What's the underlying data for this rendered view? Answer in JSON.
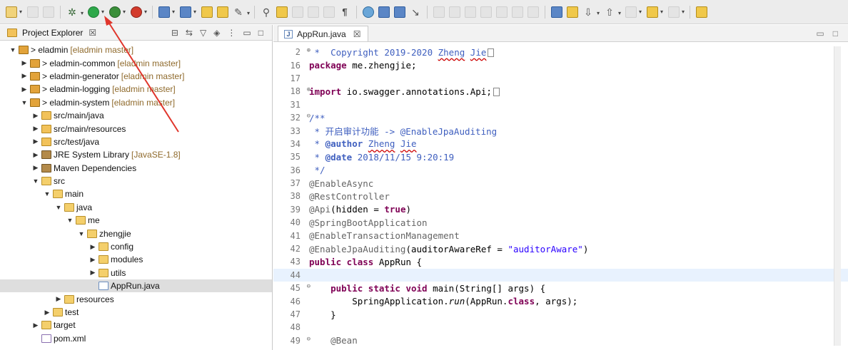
{
  "explorer": {
    "title": "Project Explorer",
    "close": "☒",
    "tree": [
      {
        "label": "> eladmin",
        "decoration": "[eladmin master]",
        "indent": 0,
        "twisty": "▼",
        "icon": "proj"
      },
      {
        "label": "> eladmin-common",
        "decoration": "[eladmin master]",
        "indent": 1,
        "twisty": "▶",
        "icon": "proj"
      },
      {
        "label": "> eladmin-generator",
        "decoration": "[eladmin master]",
        "indent": 1,
        "twisty": "▶",
        "icon": "proj"
      },
      {
        "label": "> eladmin-logging",
        "decoration": "[eladmin master]",
        "indent": 1,
        "twisty": "▶",
        "icon": "proj"
      },
      {
        "label": "> eladmin-system",
        "decoration": "[eladmin master]",
        "indent": 1,
        "twisty": "▼",
        "icon": "proj"
      },
      {
        "label": "src/main/java",
        "decoration": "",
        "indent": 2,
        "twisty": "▶",
        "icon": "pkgf"
      },
      {
        "label": "src/main/resources",
        "decoration": "",
        "indent": 2,
        "twisty": "▶",
        "icon": "pkgf"
      },
      {
        "label": "src/test/java",
        "decoration": "",
        "indent": 2,
        "twisty": "▶",
        "icon": "pkgf"
      },
      {
        "label": "JRE System Library",
        "decoration": "[JavaSE-1.8]",
        "indent": 2,
        "twisty": "▶",
        "icon": "lib"
      },
      {
        "label": "Maven Dependencies",
        "decoration": "",
        "indent": 2,
        "twisty": "▶",
        "icon": "lib"
      },
      {
        "label": "src",
        "decoration": "",
        "indent": 2,
        "twisty": "▼",
        "icon": "folder"
      },
      {
        "label": "main",
        "decoration": "",
        "indent": 3,
        "twisty": "▼",
        "icon": "folder"
      },
      {
        "label": "java",
        "decoration": "",
        "indent": 4,
        "twisty": "▼",
        "icon": "folder"
      },
      {
        "label": "me",
        "decoration": "",
        "indent": 5,
        "twisty": "▼",
        "icon": "folder"
      },
      {
        "label": "zhengjie",
        "decoration": "",
        "indent": 6,
        "twisty": "▼",
        "icon": "folder"
      },
      {
        "label": "config",
        "decoration": "",
        "indent": 7,
        "twisty": "▶",
        "icon": "folder"
      },
      {
        "label": "modules",
        "decoration": "",
        "indent": 7,
        "twisty": "▶",
        "icon": "folder"
      },
      {
        "label": "utils",
        "decoration": "",
        "indent": 7,
        "twisty": "▶",
        "icon": "folder"
      },
      {
        "label": "AppRun.java",
        "decoration": "",
        "indent": 7,
        "twisty": "",
        "icon": "java",
        "selected": true
      },
      {
        "label": "resources",
        "decoration": "",
        "indent": 4,
        "twisty": "▶",
        "icon": "folder"
      },
      {
        "label": "test",
        "decoration": "",
        "indent": 3,
        "twisty": "▶",
        "icon": "folder"
      },
      {
        "label": "target",
        "decoration": "",
        "indent": 2,
        "twisty": "▶",
        "icon": "folder"
      },
      {
        "label": "pom.xml",
        "decoration": "",
        "indent": 2,
        "twisty": "",
        "icon": "xml"
      }
    ]
  },
  "editor": {
    "tab_label": "AppRun.java",
    "tab_close": "☒",
    "tab_icon": "J",
    "lines": [
      {
        "n": "2",
        "fold": "⊕",
        "html": "<span class=\"cm\"> *  Copyright 2019-2020 <span class=\"ul\">Zheng</span> <span class=\"ul\">Jie</span></span><span class=\"box\"></span>"
      },
      {
        "n": "16",
        "fold": "",
        "html": "<span class=\"kw\">package</span> me.zhengjie;"
      },
      {
        "n": "17",
        "fold": "",
        "html": ""
      },
      {
        "n": "18",
        "fold": "⊕",
        "html": "<span class=\"kw\">import</span> io.swagger.annotations.Api;<span class=\"box\"></span>"
      },
      {
        "n": "31",
        "fold": "",
        "html": ""
      },
      {
        "n": "32",
        "fold": "⊖",
        "html": "<span class=\"cm\">/**</span>"
      },
      {
        "n": "33",
        "fold": "",
        "html": "<span class=\"cm\"> * 开启审计功能 -&gt; @EnableJpaAuditing</span>"
      },
      {
        "n": "34",
        "fold": "",
        "html": "<span class=\"cm\"> * <b>@author</b> <span class=\"ul\">Zheng</span> <span class=\"ul\">Jie</span></span>"
      },
      {
        "n": "35",
        "fold": "",
        "html": "<span class=\"cm\"> * <b>@date</b> 2018/11/15 9:20:19</span>"
      },
      {
        "n": "36",
        "fold": "",
        "html": "<span class=\"cm\"> */</span>"
      },
      {
        "n": "37",
        "fold": "",
        "html": "<span class=\"an\">@EnableAsync</span>"
      },
      {
        "n": "38",
        "fold": "",
        "html": "<span class=\"an\">@RestController</span>"
      },
      {
        "n": "39",
        "fold": "",
        "html": "<span class=\"an\">@Api</span>(hidden = <span class=\"kw\">true</span>)"
      },
      {
        "n": "40",
        "fold": "",
        "html": "<span class=\"an\">@SpringBootApplication</span>"
      },
      {
        "n": "41",
        "fold": "",
        "html": "<span class=\"an\">@EnableTransactionManagement</span>"
      },
      {
        "n": "42",
        "fold": "",
        "html": "<span class=\"an\">@EnableJpaAuditing</span>(auditorAwareRef = <span class=\"str\">\"auditorAware\"</span>)"
      },
      {
        "n": "43",
        "fold": "",
        "html": "<span class=\"kw\">public class</span> AppRun {"
      },
      {
        "n": "44",
        "fold": "",
        "html": "",
        "current": true
      },
      {
        "n": "45",
        "fold": "⊖",
        "html": "    <span class=\"kw\">public static void</span> main(String[] args) {"
      },
      {
        "n": "46",
        "fold": "",
        "html": "        SpringApplication.<span class=\"it\">run</span>(AppRun.<span class=\"kw\">class</span>, args);"
      },
      {
        "n": "47",
        "fold": "",
        "html": "    }"
      },
      {
        "n": "48",
        "fold": "",
        "html": ""
      },
      {
        "n": "49",
        "fold": "⊖",
        "html": "    <span class=\"an\">@Bean</span>"
      }
    ]
  },
  "toolbar": {
    "icons": [
      "new-icon",
      "save-icon",
      "print-icon",
      "gear-icon",
      "run-icon",
      "debug-icon",
      "stop-icon",
      "open-type-icon",
      "build-icon",
      "folder-open-icon",
      "wand-icon",
      "pin-icon",
      "pencil-icon",
      "layout-icon",
      "paragraph-icon",
      "globe-icon",
      "search-icon",
      "window-icon",
      "arrow-icon",
      "next-annotation-icon",
      "prev-annotation-icon",
      "back-icon",
      "forward-icon",
      "perspective-icon"
    ]
  },
  "colors": {
    "keyword": "#7f0055",
    "comment": "#3f5fbf",
    "string": "#2a00ff",
    "annotation": "#646464",
    "current_line": "#e8f2fe",
    "selection": "#dedede",
    "annotation_arrow": "#e0352b"
  }
}
